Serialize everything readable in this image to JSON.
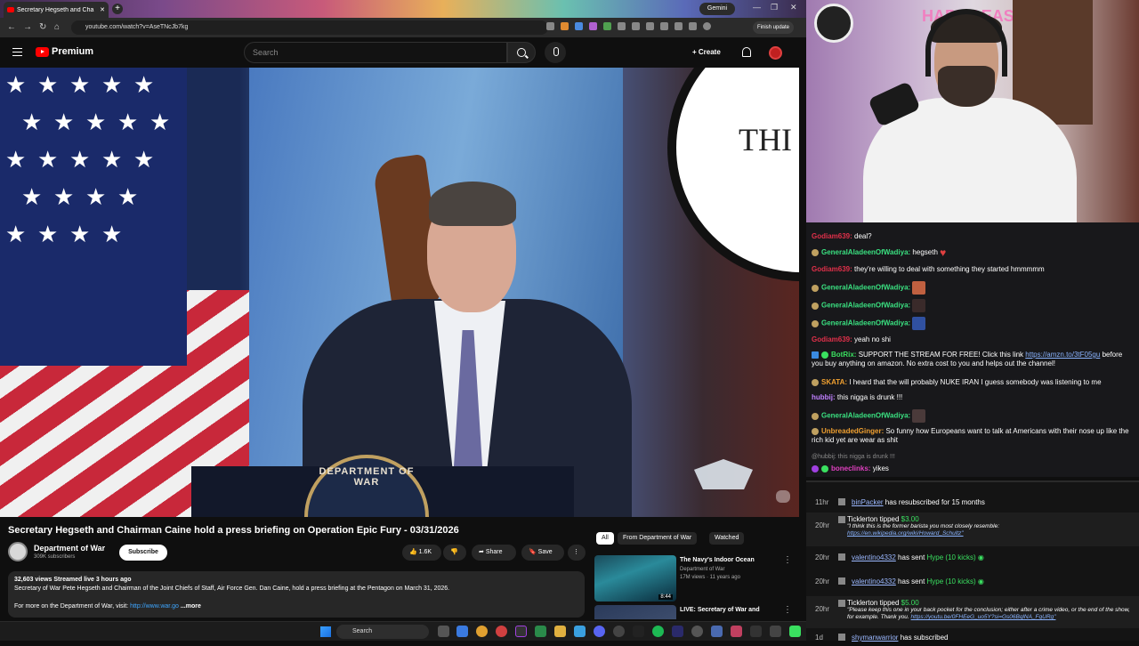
{
  "browser": {
    "tab_title": "Secretary Hegseth and Cha",
    "url": "youtube.com/watch?v=AseTNcJb7kg",
    "gemini_label": "Gemini",
    "finish_update_label": "Finish update",
    "new_tab": "+",
    "window_controls": [
      "—",
      "❐",
      "✕"
    ]
  },
  "youtube": {
    "brand": "Premium",
    "search_placeholder": "Search",
    "create_label": "+ Create"
  },
  "video": {
    "seal_text": "THI",
    "podium_text": "DEPARTMENT OF WAR",
    "title": "Secretary Hegseth and Chairman Caine hold a press briefing on Operation Epic Fury - 03/31/2026",
    "channel_name": "Department of War",
    "subscribers": "309K subscribers",
    "subscribe_label": "Subscribe",
    "likes": "1.6K",
    "share_label": "Share",
    "save_label": "Save",
    "more_label": "⋮",
    "desc_stats": "32,603 views  Streamed live 3 hours ago",
    "desc_text": "Secretary of War Pete Hegseth and Chairman of the Joint Chiefs of Staff, Air Force Gen. Dan Caine, hold a press briefing at the Pentagon on March 31, 2026.",
    "desc_more_prefix": "For more on the Department of War, visit: ",
    "desc_link": "http://www.war.go",
    "desc_more": "...more"
  },
  "recommendations": {
    "chips": [
      "All",
      "From Department of War",
      "Watched"
    ],
    "items": [
      {
        "title": "The Navy's Indoor Ocean",
        "channel": "Department of War",
        "meta": "17M views · 11 years ago",
        "duration": "8:44",
        "more": "⋮"
      },
      {
        "title": "LIVE: Secretary of War and",
        "channel": "",
        "meta": "",
        "duration": "",
        "more": "⋮"
      }
    ]
  },
  "chat": {
    "messages": [
      {
        "user": "Godiam639:",
        "text": "deal?",
        "color": "#e0304a"
      },
      {
        "user": "GeneralAladeenOfWadiya:",
        "text": "hegseth",
        "color": "#3ae080"
      },
      {
        "user": "Godiam639:",
        "text": "they're willing to deal with something they started hmmmmm",
        "color": "#e0304a"
      },
      {
        "user": "GeneralAladeenOfWadiya:",
        "text": "",
        "color": "#3ae080"
      },
      {
        "user": "GeneralAladeenOfWadiya:",
        "text": "",
        "color": "#3ae080"
      },
      {
        "user": "GeneralAladeenOfWadiya:",
        "text": "",
        "color": "#3ae080"
      },
      {
        "user": "Godiam639:",
        "text": "yeah no shi",
        "color": "#e0304a"
      },
      {
        "user": "BotRix:",
        "text": "SUPPORT THE STREAM FOR FREE! Click this link ",
        "link": "https://amzn.to/3tF05gu",
        "text2": "before you buy anything on amazon. No extra cost to you and helps out the channel!",
        "color": "#3ae060"
      },
      {
        "user": "SKATA:",
        "text": "I heard that the will probably NUKE IRAN I guess somebody was listening to me",
        "color": "#f0a030"
      },
      {
        "user": "hubbij:",
        "text": "this nigga is drunk !!!",
        "color": "#c080ff"
      },
      {
        "user": "GeneralAladeenOfWadiya:",
        "text": "",
        "color": "#3ae080"
      },
      {
        "user": "UnbreadedGinger:",
        "text": "So funny how Europeans want to talk at Americans with their nose up like the rich kid yet are wear as shit",
        "color": "#f0a030"
      },
      {
        "user": "",
        "text": "@hubbij: this nigga is drunk !!!",
        "color": "#888888"
      },
      {
        "user": "boneclinks:",
        "text": "yikes",
        "color": "#e040c0"
      }
    ]
  },
  "events": [
    {
      "time": "11hr",
      "user": "binPacker",
      "text": " has resubscribed for 15 months"
    },
    {
      "time": "20hr",
      "user": "Ticklerton",
      "text": " tipped ",
      "amount": "$3.00",
      "note": "\"I think this is the former barista you most closely resemble:",
      "note_link": "https://en.wikipedia.org/wiki/Howard_Schultz\""
    },
    {
      "time": "20hr",
      "user": "valentino4332",
      "text": " has sent ",
      "hype": "Hype (10 kicks)"
    },
    {
      "time": "20hr",
      "user": "valentino4332",
      "text": " has sent ",
      "hype": "Hype (10 kicks)"
    },
    {
      "time": "20hr",
      "user": "Ticklerton",
      "text": " tipped ",
      "amount": "$5.00",
      "note": "\"Please keep this one in your back pocket for the conclusion; either after a crime video, or the end of the show, for example. Thank you. ",
      "note_link": "https://youtu.be/0FHEeG_uo5Y?si=Gs06BqlNA_FqURg\""
    },
    {
      "time": "1d",
      "user": "shymanwarrior",
      "text": " has subscribed"
    }
  ],
  "webcam": {
    "wall_text": "HAPPY EAST"
  },
  "taskbar": {
    "search_label": "Search"
  }
}
